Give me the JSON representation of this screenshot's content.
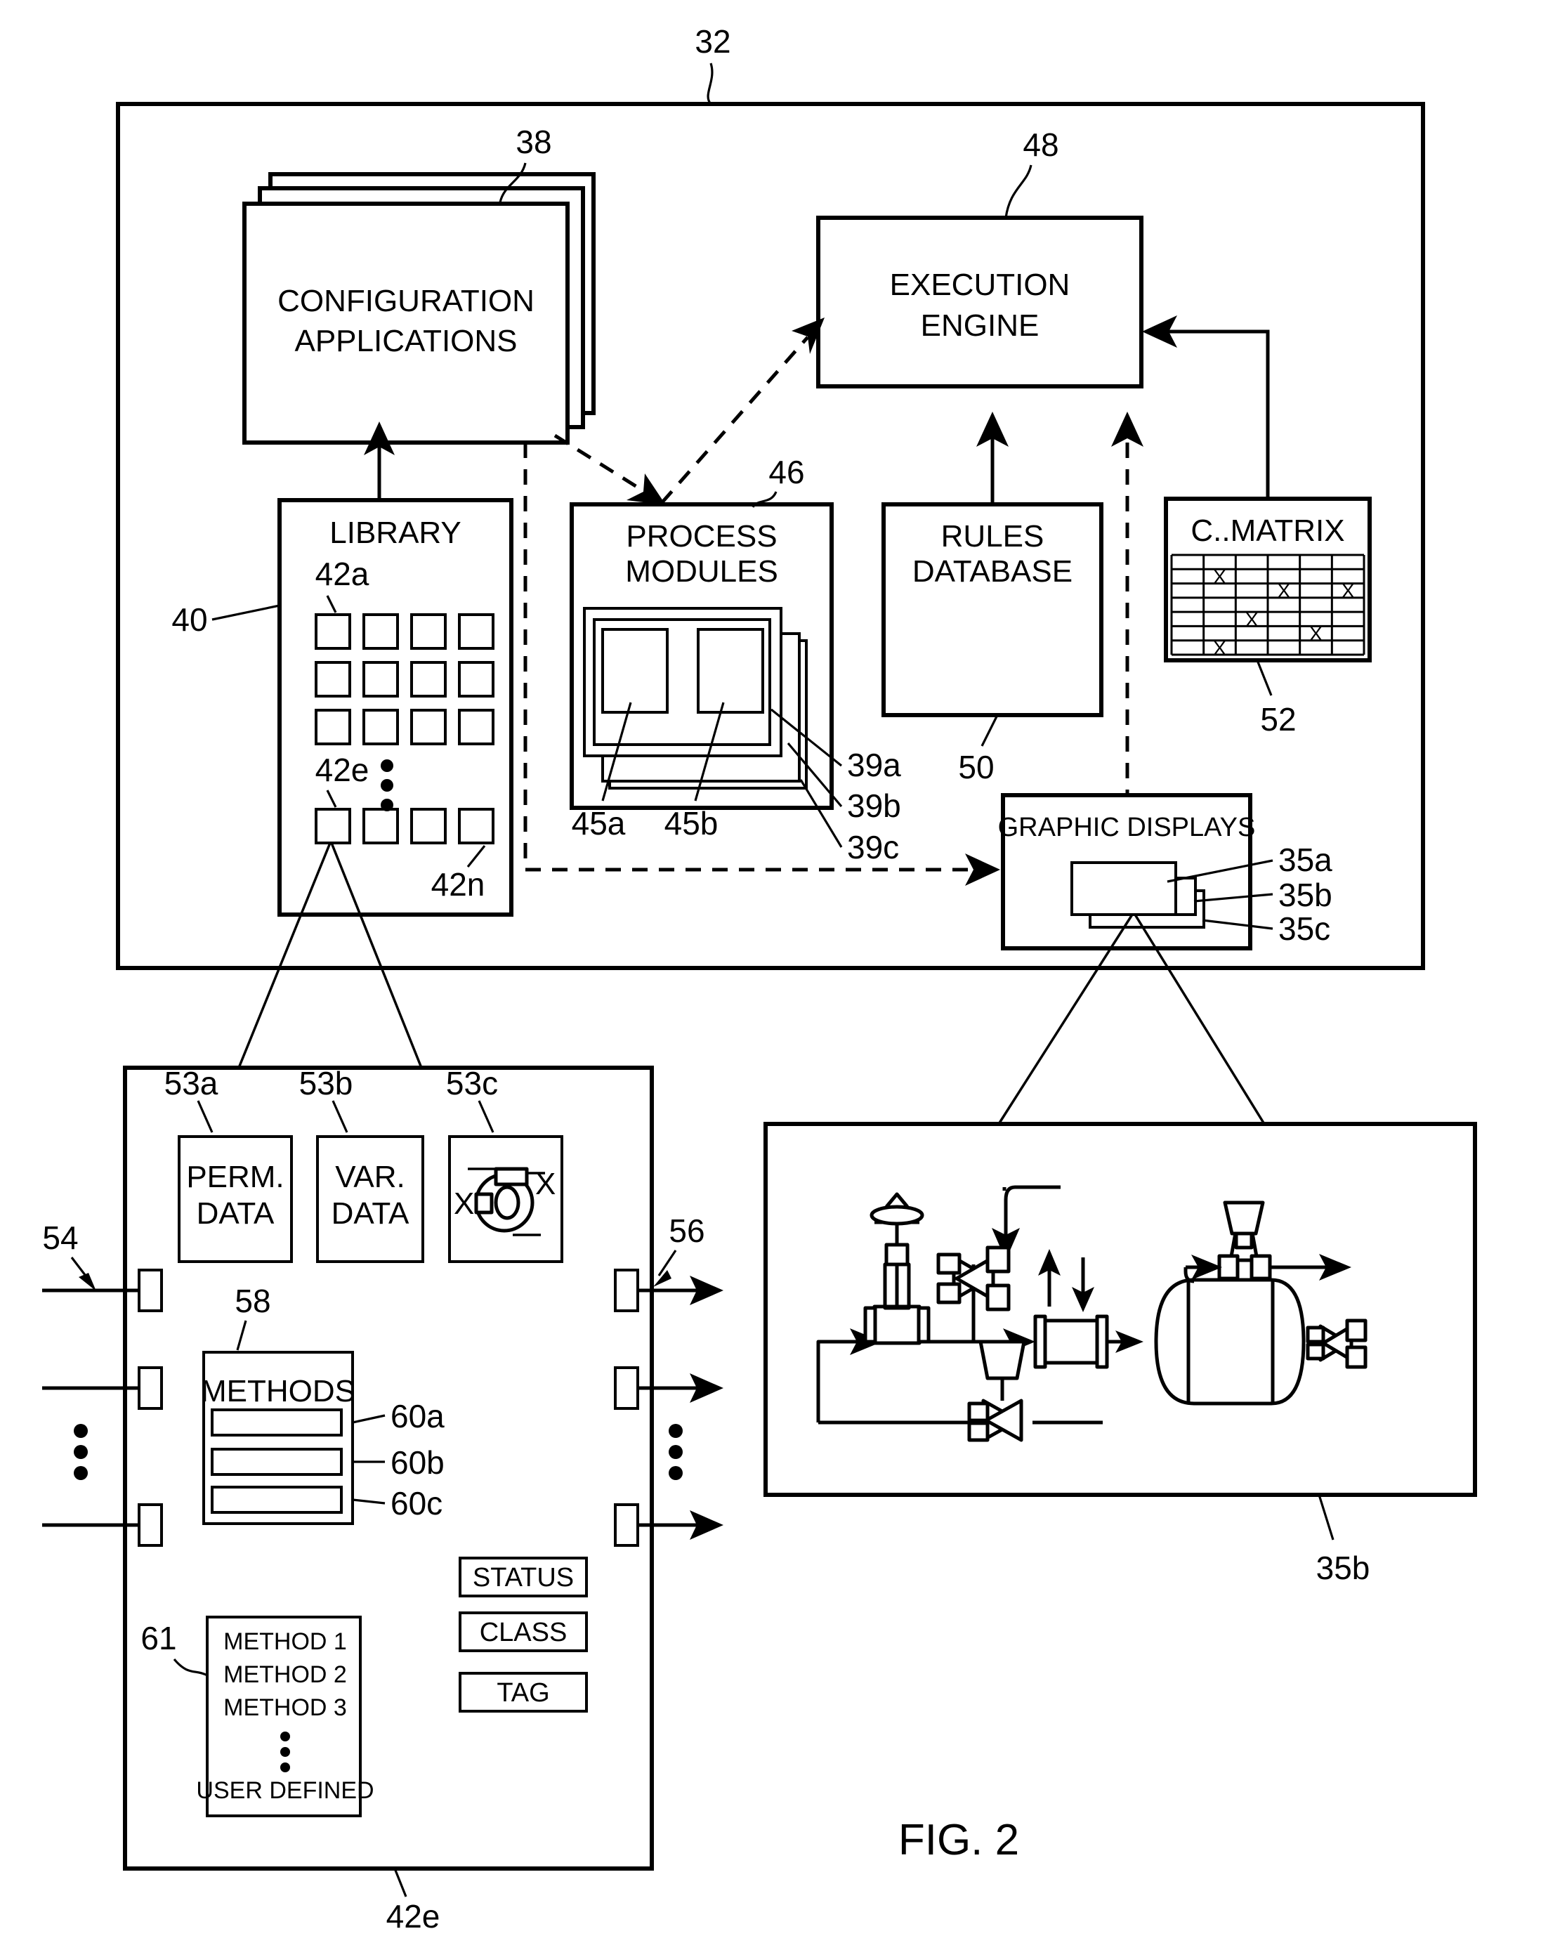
{
  "figure": {
    "caption": "FIG. 2",
    "outer_ref": "32"
  },
  "top_section": {
    "config_apps": {
      "label_line1": "CONFIGURATION",
      "label_line2": "APPLICATIONS",
      "ref": "38"
    },
    "execution_engine": {
      "label_line1": "EXECUTION",
      "label_line2": "ENGINE",
      "ref": "48"
    },
    "library": {
      "label": "LIBRARY",
      "ref": "40",
      "item_first": "42a",
      "item_mid": "42e",
      "item_last": "42n",
      "rows": 4,
      "cols": 4
    },
    "process_modules": {
      "label_line1": "PROCESS",
      "label_line2": "MODULES",
      "ref": "46",
      "stack_refs": [
        "39a",
        "39b",
        "39c"
      ],
      "inner_refs": [
        "45a",
        "45b"
      ]
    },
    "rules_database": {
      "label_line1": "RULES",
      "label_line2": "DATABASE",
      "ref": "50"
    },
    "c_matrix": {
      "label": "C..MATRIX",
      "ref": "52",
      "cols": 6,
      "rows": 7,
      "x_cells": [
        [
          2,
          2
        ],
        [
          3,
          4
        ],
        [
          3,
          6
        ],
        [
          5,
          3
        ],
        [
          6,
          5
        ],
        [
          7,
          2
        ]
      ]
    },
    "graphic_displays": {
      "label": "GRAPHIC DISPLAYS",
      "stack_refs": [
        "35a",
        "35b",
        "35c"
      ]
    }
  },
  "module_detail": {
    "ref": "42e",
    "perm_data": {
      "label_line1": "PERM.",
      "label_line2": "DATA",
      "ref": "53a"
    },
    "var_data": {
      "label_line1": "VAR.",
      "label_line2": "DATA",
      "ref": "53b"
    },
    "graphic_cell": {
      "ref": "53c",
      "mark_left": "X",
      "mark_right": "X"
    },
    "inputs": {
      "ref": "54",
      "count": 3
    },
    "outputs": {
      "ref": "56",
      "count": 3
    },
    "methods": {
      "label": "METHODS",
      "ref": "58",
      "slot_refs": [
        "60a",
        "60b",
        "60c"
      ]
    },
    "method_list": {
      "ref": "61",
      "items": [
        "METHOD 1",
        "METHOD 2",
        "METHOD 3"
      ],
      "ellipsis": "⋮",
      "last": "USER DEFINED"
    },
    "attributes": [
      {
        "label": "STATUS"
      },
      {
        "label": "CLASS"
      },
      {
        "label": "TAG"
      }
    ]
  },
  "display_detail": {
    "ref": "35b",
    "elements": [
      "hand-valve",
      "control-valve-top",
      "control-valve-bottom",
      "flow-element",
      "tank",
      "tank-outlet-valve",
      "discharge-valve"
    ]
  }
}
